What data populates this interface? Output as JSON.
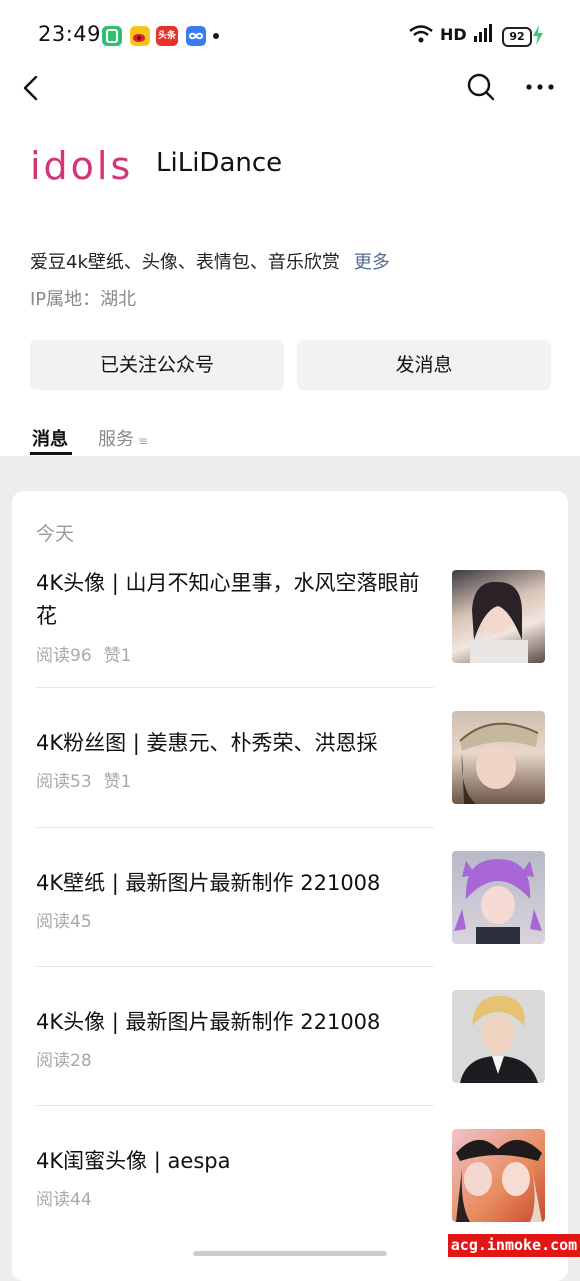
{
  "status_bar": {
    "time": "23:49",
    "network": "HD",
    "battery": "92",
    "app_icons": [
      "wechat-work-icon",
      "weibo-icon",
      "toutiao-icon",
      "infinity-app-icon"
    ],
    "toutiao_label": "头条"
  },
  "nav": {
    "back_icon": "chevron-left-icon",
    "search_icon": "search-icon",
    "more_icon": "more-dots-icon"
  },
  "profile": {
    "logo_text": "idols",
    "name": "LiLiDance",
    "description": "爱豆4k壁纸、头像、表情包、音乐欣赏",
    "more_label": "更多",
    "ip_location": "IP属地：湖北"
  },
  "actions": {
    "follow_label": "已关注公众号",
    "message_label": "发消息"
  },
  "tabs": {
    "messages": "消息",
    "services": "服务",
    "services_glyph": "≡"
  },
  "feed": {
    "date_header": "今天",
    "articles": [
      {
        "title": "4K头像 | 山月不知心里事，水风空落眼前花",
        "reads": "阅读96",
        "likes": "赞1"
      },
      {
        "title": "4K粉丝图 | 姜惠元、朴秀荣、洪恩採",
        "reads": "阅读53",
        "likes": "赞1"
      },
      {
        "title": "4K壁纸 | 最新图片最新制作 221008",
        "reads": "阅读45",
        "likes": ""
      },
      {
        "title": "4K头像 | 最新图片最新制作 221008",
        "reads": "阅读28",
        "likes": ""
      },
      {
        "title": "4K闺蜜头像 | aespa",
        "reads": "阅读44",
        "likes": ""
      }
    ]
  },
  "watermark": "acg.inmoke.com",
  "colors": {
    "link": "#576b95",
    "logo_pink": "#d4357a",
    "background": "#ededed",
    "watermark_bg": "#e41515"
  }
}
